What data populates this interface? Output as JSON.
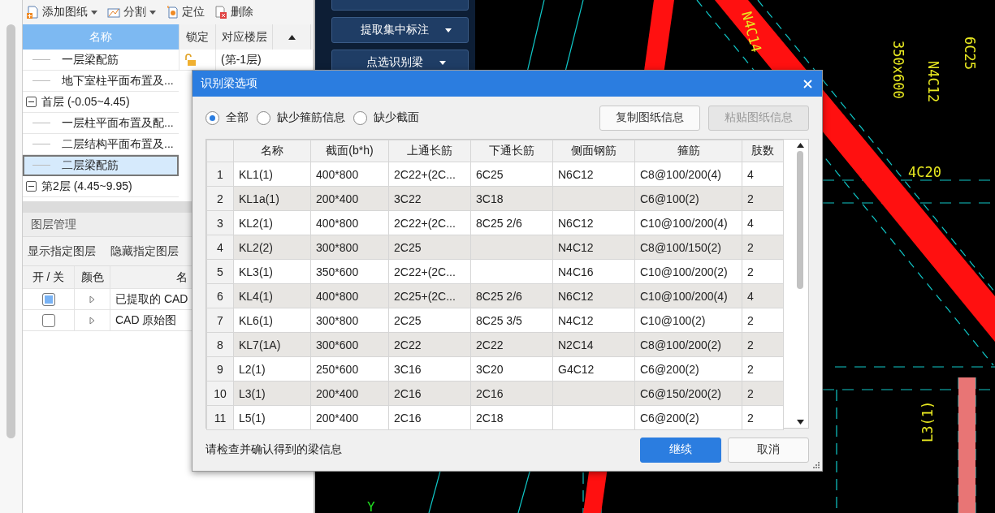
{
  "toolbar": [
    {
      "kind": "add",
      "label": "添加图纸",
      "dropdown": true
    },
    {
      "kind": "split",
      "label": "分割",
      "dropdown": true
    },
    {
      "kind": "locate",
      "label": "定位",
      "dropdown": false
    },
    {
      "kind": "delete",
      "label": "删除",
      "dropdown": false
    }
  ],
  "drawings": {
    "columns": [
      "名称",
      "锁定",
      "对应楼层"
    ],
    "items": [
      {
        "label": "一层梁配筋",
        "selected": false,
        "locked": false,
        "floor": "(第-1层)"
      },
      {
        "label": "地下室柱平面布置及...",
        "selected": false
      },
      {
        "label": "首层 (-0.05~4.45)",
        "expanded": true,
        "selected": false,
        "children": [
          {
            "label": "一层柱平面布置及配...",
            "selected": false
          },
          {
            "label": "二层结构平面布置及...",
            "selected": false
          },
          {
            "label": "二层梁配筋",
            "selected": true
          }
        ]
      },
      {
        "label": "第2层 (4.45~9.95)",
        "expanded": true,
        "selected": false
      }
    ]
  },
  "layers": {
    "title": "图层管理",
    "actions": [
      "显示指定图层",
      "隐藏指定图层"
    ],
    "columns": [
      "开 / 关",
      "颜色",
      "名"
    ],
    "rows": [
      {
        "on": true,
        "name": "已提取的 CAD"
      },
      {
        "on": false,
        "name": "CAD 原始图"
      }
    ]
  },
  "tools": [
    {
      "label": "提取集中标注",
      "dropdown": true
    },
    {
      "label": "点选识别梁",
      "dropdown": true
    }
  ],
  "cad_labels": [
    {
      "text": "N4C14",
      "kind": "note"
    },
    {
      "text": "6C25",
      "kind": "note"
    },
    {
      "text": "N4C12",
      "kind": "note"
    },
    {
      "text": "350x600",
      "kind": "note"
    },
    {
      "text": "4C20",
      "kind": "note"
    },
    {
      "text": "L3(1)",
      "kind": "note"
    },
    {
      "text": "Y",
      "kind": "axis"
    }
  ],
  "dialog": {
    "title": "识别梁选项",
    "filters": [
      {
        "label": "全部",
        "selected": true
      },
      {
        "label": "缺少箍筋信息",
        "selected": false
      },
      {
        "label": "缺少截面",
        "selected": false
      }
    ],
    "actions": [
      {
        "label": "复制图纸信息",
        "disabled": false
      },
      {
        "label": "粘贴图纸信息",
        "disabled": true
      }
    ],
    "table": {
      "columns": [
        "名称",
        "截面(b*h)",
        "上通长筋",
        "下通长筋",
        "侧面钢筋",
        "箍筋",
        "肢数"
      ],
      "rows": [
        {
          "index": "1",
          "cells": [
            "KL1(1)",
            "400*800",
            "2C22+(2C...",
            "6C25",
            "N6C12",
            "C8@100/200(4)",
            "4"
          ]
        },
        {
          "index": "2",
          "cells": [
            "KL1a(1)",
            "200*400",
            "3C22",
            "3C18",
            "",
            "C6@100(2)",
            "2"
          ]
        },
        {
          "index": "3",
          "cells": [
            "KL2(1)",
            "400*800",
            "2C22+(2C...",
            "8C25 2/6",
            "N6C12",
            "C10@100/200(4)",
            "4"
          ]
        },
        {
          "index": "4",
          "cells": [
            "KL2(2)",
            "300*800",
            "2C25",
            "",
            "N4C12",
            "C8@100/150(2)",
            "2"
          ]
        },
        {
          "index": "5",
          "cells": [
            "KL3(1)",
            "350*600",
            "2C22+(2C...",
            "",
            "N4C16",
            "C10@100/200(2)",
            "2"
          ]
        },
        {
          "index": "6",
          "cells": [
            "KL4(1)",
            "400*800",
            "2C25+(2C...",
            "8C25 2/6",
            "N6C12",
            "C10@100/200(4)",
            "4"
          ]
        },
        {
          "index": "7",
          "cells": [
            "KL6(1)",
            "300*800",
            "2C25",
            "8C25 3/5",
            "N4C12",
            "C10@100(2)",
            "2"
          ]
        },
        {
          "index": "8",
          "cells": [
            "KL7(1A)",
            "300*600",
            "2C22",
            "2C22",
            "N2C14",
            "C8@100/200(2)",
            "2"
          ]
        },
        {
          "index": "9",
          "cells": [
            "L2(1)",
            "250*600",
            "3C16",
            "3C20",
            "G4C12",
            "C6@200(2)",
            "2"
          ]
        },
        {
          "index": "10",
          "cells": [
            "L3(1)",
            "200*400",
            "2C16",
            "2C16",
            "",
            "C6@150/200(2)",
            "2"
          ]
        },
        {
          "index": "11",
          "cells": [
            "L5(1)",
            "200*400",
            "2C16",
            "2C18",
            "",
            "C6@200(2)",
            "2"
          ]
        }
      ]
    },
    "hint": "请检查并确认得到的梁信息",
    "buttons": [
      {
        "label": "继续",
        "kind": "primary"
      },
      {
        "label": "取消",
        "kind": "secondary"
      }
    ]
  }
}
